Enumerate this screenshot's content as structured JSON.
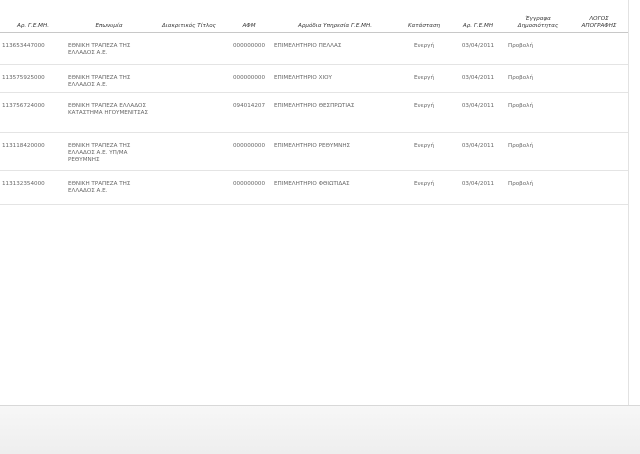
{
  "table": {
    "headers": {
      "gemi": "Αρ. Γ.Ε.ΜΗ.",
      "name": "Επωνυμία",
      "title_distinct": "Διακριτικός Τίτλος",
      "afm": "ΑΦΜ",
      "service": "Αρμόδια Υπηρεσία Γ.Ε.ΜΗ.",
      "status": "Κατάσταση",
      "date": "Αρ. Γ.Ε.ΜΗ",
      "docs": "Έγγραφα Δημοσιότητας",
      "withdrawal": "ΛΟΓΟΣ ΑΠΟΓΡΑΦΗΣ"
    },
    "rows": [
      {
        "gemi": "113653447000",
        "name": "ΕΘΝΙΚΗ ΤΡΑΠΕΖΑ ΤΗΣ ΕΛΛΑΔΟΣ Α.Ε.",
        "title_distinct": "",
        "afm": "000000000",
        "service": "ΕΠΙΜΕΛΗΤΗΡΙΟ ΠΕΛΛΑΣ",
        "status": "Ενεργή",
        "date": "03/04/2011",
        "docs": "Προβολή"
      },
      {
        "gemi": "113575925000",
        "name": "ΕΘΝΙΚΗ ΤΡΑΠΕΖΑ ΤΗΣ ΕΛΛΑΔΟΣ Α.Ε.",
        "title_distinct": "",
        "afm": "000000000",
        "service": "ΕΠΙΜΕΛΗΤΗΡΙΟ ΧΙΟΥ",
        "status": "Ενεργή",
        "date": "03/04/2011",
        "docs": "Προβολή"
      },
      {
        "gemi": "113756724000",
        "name": "ΕΘΝΙΚΗ ΤΡΑΠΕΖΑ ΕΛΛΑΔΟΣ ΚΑΤΑΣΤΗΜΑ ΗΓΟΥΜΕΝΙΤΣΑΣ",
        "title_distinct": "",
        "afm": "094014207",
        "service": "ΕΠΙΜΕΛΗΤΗΡΙΟ ΘΕΣΠΡΩΤΙΑΣ",
        "status": "Ενεργή",
        "date": "03/04/2011",
        "docs": "Προβολή"
      },
      {
        "gemi": "113118420000",
        "name": "ΕΘΝΙΚΗ ΤΡΑΠΕΖΑ ΤΗΣ ΕΛΛΑΔΟΣ Α.Ε. ΥΠ/ΜΑ ΡΕΘΥΜΝΗΣ",
        "title_distinct": "",
        "afm": "000000000",
        "service": "ΕΠΙΜΕΛΗΤΗΡΙΟ ΡΕΘΥΜΝΗΣ",
        "status": "Ενεργή",
        "date": "03/04/2011",
        "docs": "Προβολή"
      },
      {
        "gemi": "113132354000",
        "name": "ΕΘΝΙΚΗ ΤΡΑΠΕΖΑ ΤΗΣ ΕΛΛΑΔΟΣ Α.Ε.",
        "title_distinct": "",
        "afm": "000000000",
        "service": "ΕΠΙΜΕΛΗΤΗΡΙΟ ΦΘΙΩΤΙΔΑΣ",
        "status": "Ενεργή",
        "date": "03/04/2011",
        "docs": "Προβολή"
      }
    ]
  }
}
